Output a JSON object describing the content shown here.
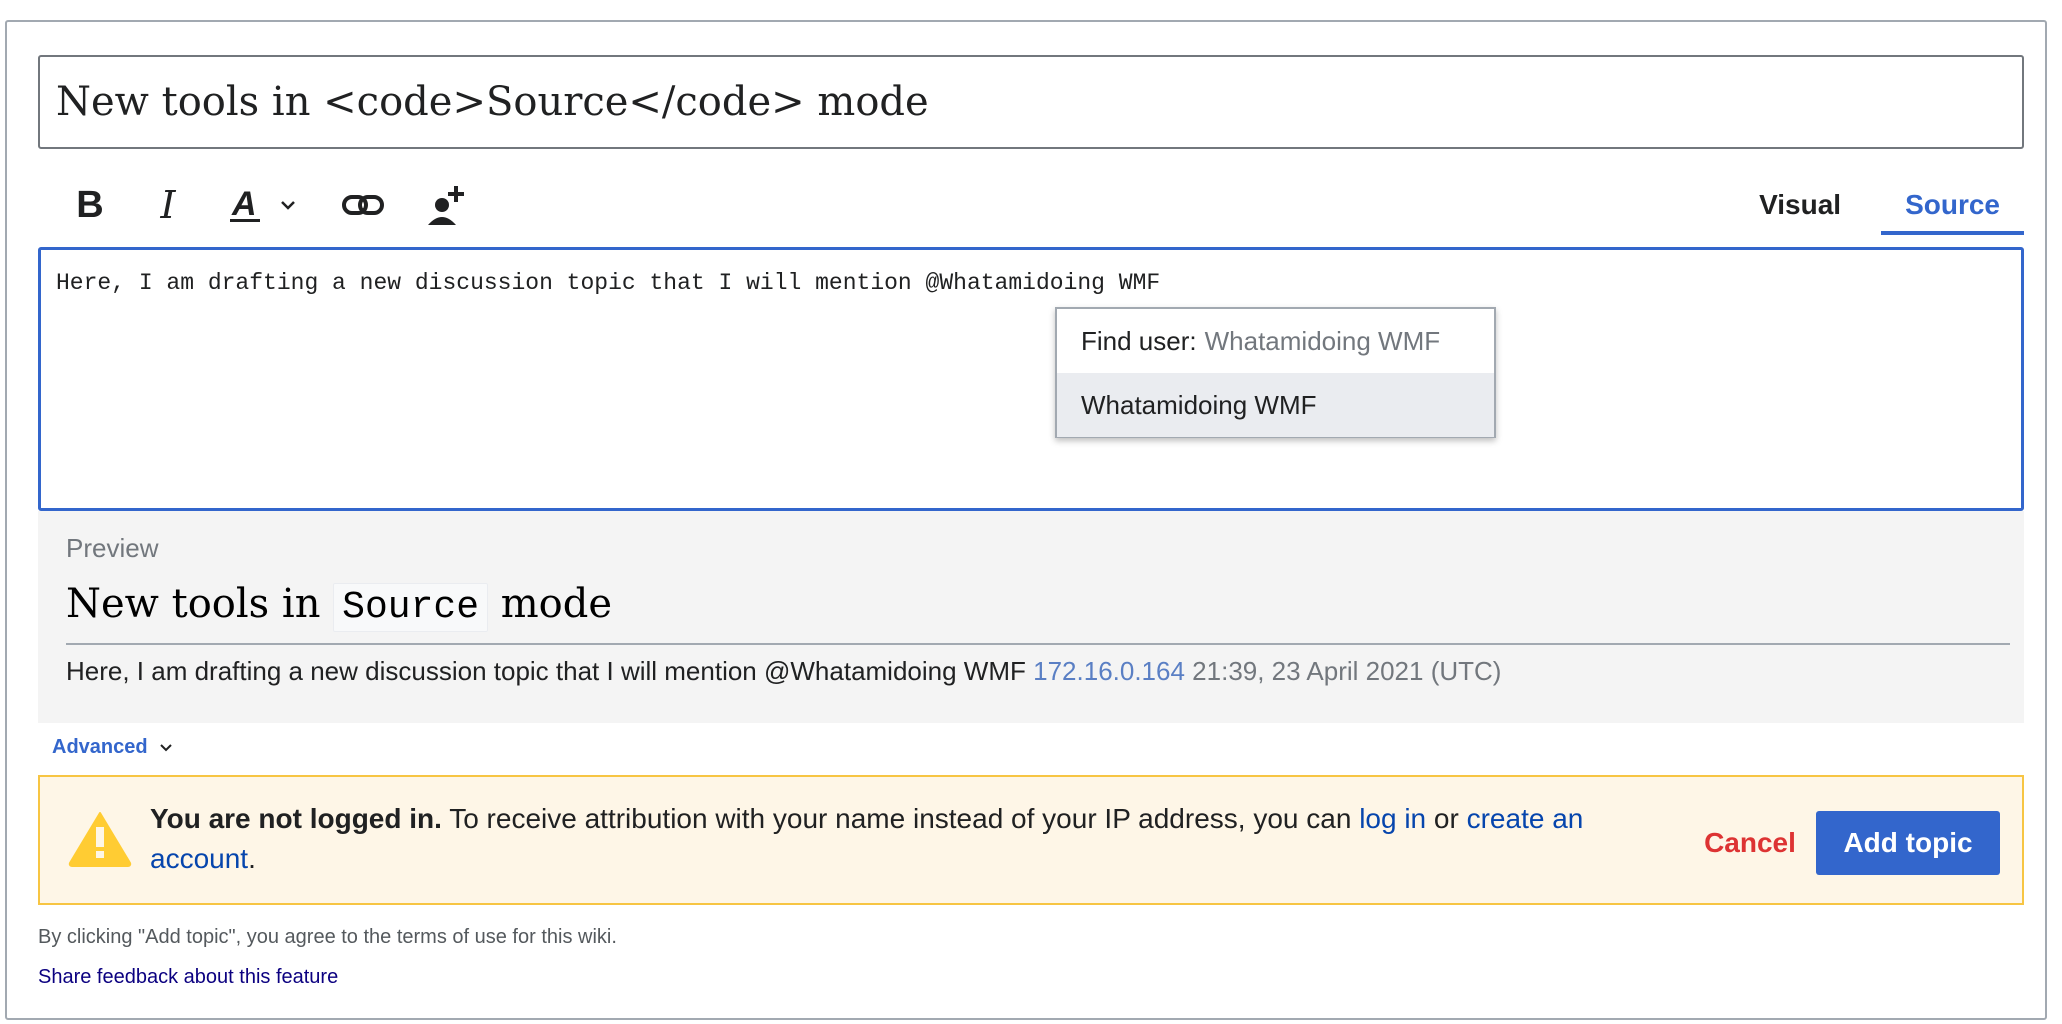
{
  "title_input": {
    "value": "New tools in <code>Source</code> mode"
  },
  "toolbar": {
    "bold_label": "B",
    "italic_label": "I",
    "icons": [
      "bold-icon",
      "italic-icon",
      "text-style-icon",
      "link-icon",
      "mention-user-icon"
    ]
  },
  "tabs": [
    {
      "label": "Visual",
      "active": false
    },
    {
      "label": "Source",
      "active": true
    }
  ],
  "editor": {
    "value": "Here, I am drafting a new discussion topic that I will mention @Whatamidoing WMF"
  },
  "mention_dropdown": {
    "find_label": "Find user:",
    "find_query": "Whatamidoing WMF",
    "suggestions": [
      "Whatamidoing WMF"
    ]
  },
  "preview": {
    "label": "Preview",
    "title_before": "New tools in",
    "title_code": "Source",
    "title_after": "mode",
    "body_text": "Here, I am drafting a new discussion topic that I will mention @Whatamidoing WMF",
    "signature_ip": "172.16.0.164",
    "timestamp": "21:39, 23 April 2021 (UTC)"
  },
  "advanced": {
    "label": "Advanced"
  },
  "warning": {
    "bold": "You are not logged in.",
    "text": "To receive attribution with your name instead of your IP address, you can",
    "login_link": "log in",
    "or": "or",
    "create_link": "create an account",
    "end": "."
  },
  "actions": {
    "cancel_label": "Cancel",
    "add_label": "Add topic"
  },
  "footer": {
    "terms": "By clicking \"Add topic\", you agree to the terms of use for this wiki.",
    "feedback_link": "Share feedback about this feature"
  },
  "colors": {
    "accent": "#3366cc",
    "destructive": "#d33333",
    "warning_bg": "#fef6e7",
    "warning_border": "#f7c543"
  }
}
